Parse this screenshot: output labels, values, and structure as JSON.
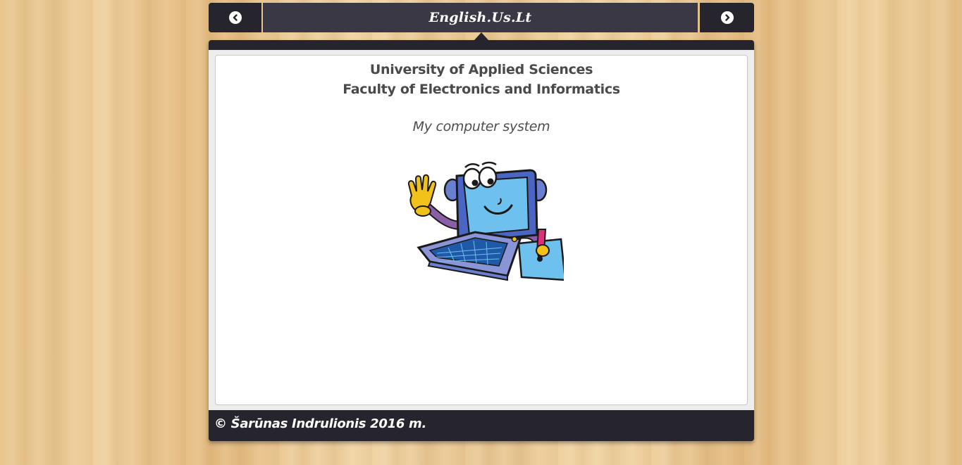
{
  "header": {
    "title": "English.Us.Lt",
    "prev_icon": "chevron-circle-left-icon",
    "next_icon": "chevron-circle-right-icon"
  },
  "content": {
    "university": "University of Applied Sciences",
    "faculty": "Faculty of Electronics and Informatics",
    "subtitle": "My computer system",
    "illustration": "cartoon-laptop-character"
  },
  "footer": {
    "copyright": "© Šarūnas Indrulionis 2016 m."
  },
  "colors": {
    "nav_dark": "#26252e",
    "nav_title_bg": "#393844",
    "panel_inner_bg": "#ededed",
    "card_bg": "#ffffff",
    "text": "#4a4a4a",
    "wood": "#e9c58e"
  }
}
